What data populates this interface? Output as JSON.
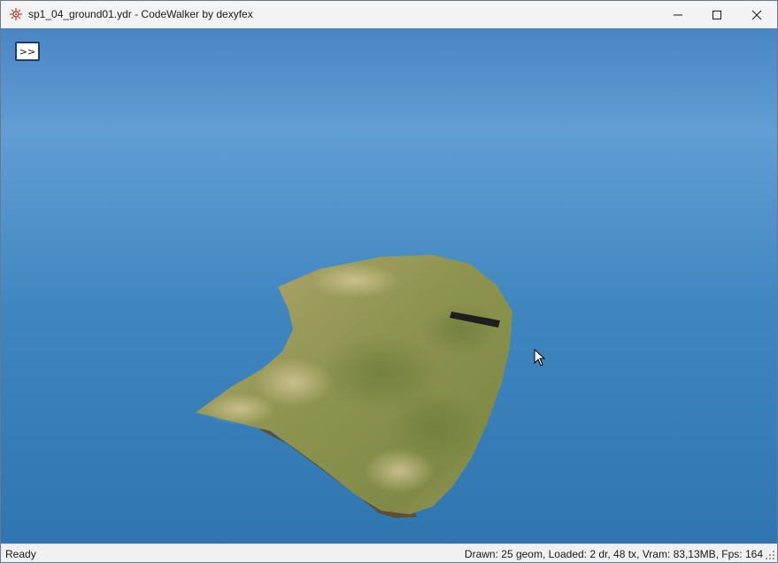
{
  "window": {
    "title": "sp1_04_ground01.ydr - CodeWalker by dexyfex",
    "app_icon": "codewalker-icon"
  },
  "titlebar": {
    "minimize_icon": "minimize-icon",
    "maximize_icon": "maximize-icon",
    "close_icon": "close-icon"
  },
  "viewport": {
    "toggle_label": ">>",
    "sky_color_top": "#4a86c4",
    "sky_color_mid": "#609ed3",
    "sky_color_bottom": "#2f76b0",
    "terrain_color": "#9c9a5c",
    "cursor_icon": "mouse-pointer-icon"
  },
  "status": {
    "left": "Ready",
    "right": "Drawn: 25 geom, Loaded: 2 dr, 48 tx, Vram: 83,13MB, Fps: 164"
  }
}
